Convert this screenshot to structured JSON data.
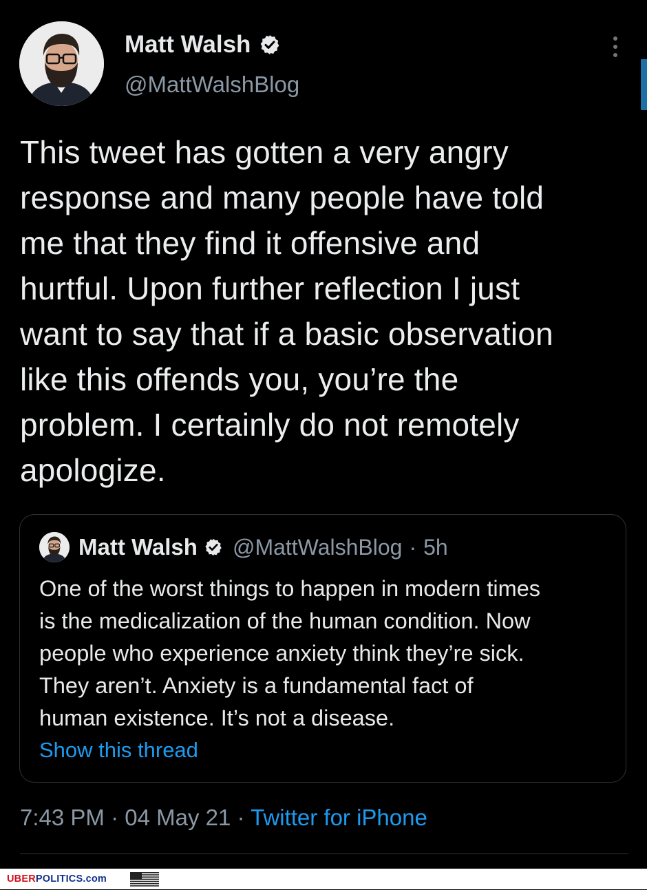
{
  "author": {
    "name": "Matt Walsh",
    "handle": "@MattWalshBlog"
  },
  "tweet": {
    "text": "This tweet has gotten a very angry\nresponse and many people have told\nme that they find it offensive and\nhurtful. Upon further reflection I just\nwant to say that if a basic observation\nlike this offends you, you’re the\nproblem. I certainly do not remotely\napologize."
  },
  "quoted": {
    "name": "Matt Walsh",
    "handle": "@MattWalshBlog",
    "separator": "·",
    "time": "5h",
    "text": "One of the worst things to happen in modern times\nis the medicalization of the human condition. Now\npeople who experience anxiety think they’re sick.\nThey aren’t. Anxiety is a fundamental fact of\nhuman existence. It’s not a disease.",
    "show_thread": "Show this thread"
  },
  "meta": {
    "time": "7:43 PM",
    "sep1": " · ",
    "date": "04 May 21",
    "sep2": " · ",
    "source": "Twitter for iPhone"
  },
  "watermark": {
    "part1": "UBER",
    "part2": "POLITICS.com"
  },
  "icons": {
    "verified": "verified-badge-icon",
    "more": "more-vertical-icon",
    "flag": "us-flag-icon"
  },
  "colors": {
    "background": "#000000",
    "text": "#e7e9ea",
    "secondary": "#8b98a5",
    "link": "#1d9bf0",
    "border": "#2f3336"
  }
}
